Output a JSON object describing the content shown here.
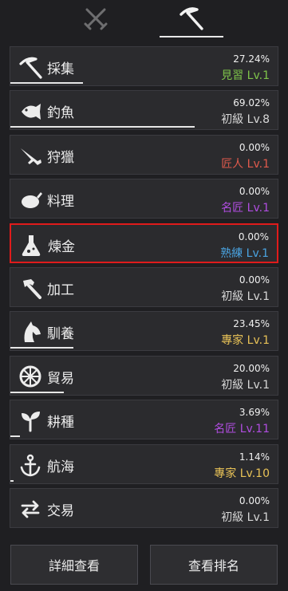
{
  "tabs": [
    {
      "name": "combat",
      "icon": "crossed-swords-icon",
      "active": false
    },
    {
      "name": "life",
      "icon": "pickaxe-icon",
      "active": true
    }
  ],
  "skills": [
    {
      "name": "採集",
      "percent": "27.24%",
      "rank": "見習",
      "level": "Lv.1",
      "rank_color": "green",
      "progress": 0.2724,
      "icon": "pickaxe-icon"
    },
    {
      "name": "釣魚",
      "percent": "69.02%",
      "rank": "初級",
      "level": "Lv.8",
      "rank_color": "white",
      "progress": 0.6902,
      "icon": "fish-icon"
    },
    {
      "name": "狩獵",
      "percent": "0.00%",
      "rank": "匠人",
      "level": "Lv.1",
      "rank_color": "red",
      "progress": 0.0,
      "icon": "rifle-icon"
    },
    {
      "name": "料理",
      "percent": "0.00%",
      "rank": "名匠",
      "level": "Lv.1",
      "rank_color": "purple",
      "progress": 0.0,
      "icon": "roast-chicken-icon"
    },
    {
      "name": "煉金",
      "percent": "0.00%",
      "rank": "熟練",
      "level": "Lv.1",
      "rank_color": "blue",
      "progress": 0.0,
      "icon": "flask-icon",
      "highlighted": true
    },
    {
      "name": "加工",
      "percent": "0.00%",
      "rank": "初級",
      "level": "Lv.1",
      "rank_color": "white",
      "progress": 0.0,
      "icon": "hammer-icon"
    },
    {
      "name": "馴養",
      "percent": "23.45%",
      "rank": "專家",
      "level": "Lv.1",
      "rank_color": "gold",
      "progress": 0.2345,
      "icon": "horse-head-icon"
    },
    {
      "name": "貿易",
      "percent": "20.00%",
      "rank": "初級",
      "level": "Lv.1",
      "rank_color": "white",
      "progress": 0.2,
      "icon": "wheel-icon"
    },
    {
      "name": "耕種",
      "percent": "3.69%",
      "rank": "名匠",
      "level": "Lv.11",
      "rank_color": "purple",
      "progress": 0.0369,
      "icon": "sprout-icon"
    },
    {
      "name": "航海",
      "percent": "1.14%",
      "rank": "專家",
      "level": "Lv.10",
      "rank_color": "gold",
      "progress": 0.0114,
      "icon": "anchor-icon"
    },
    {
      "name": "交易",
      "percent": "0.00%",
      "rank": "初級",
      "level": "Lv.1",
      "rank_color": "white",
      "progress": 0.0,
      "icon": "exchange-arrows-icon"
    }
  ],
  "buttons": {
    "detail": "詳細查看",
    "ranking": "查看排名"
  },
  "colors": {
    "highlight_border": "#e01b1b",
    "progress_bar": "#e6e6e6"
  }
}
